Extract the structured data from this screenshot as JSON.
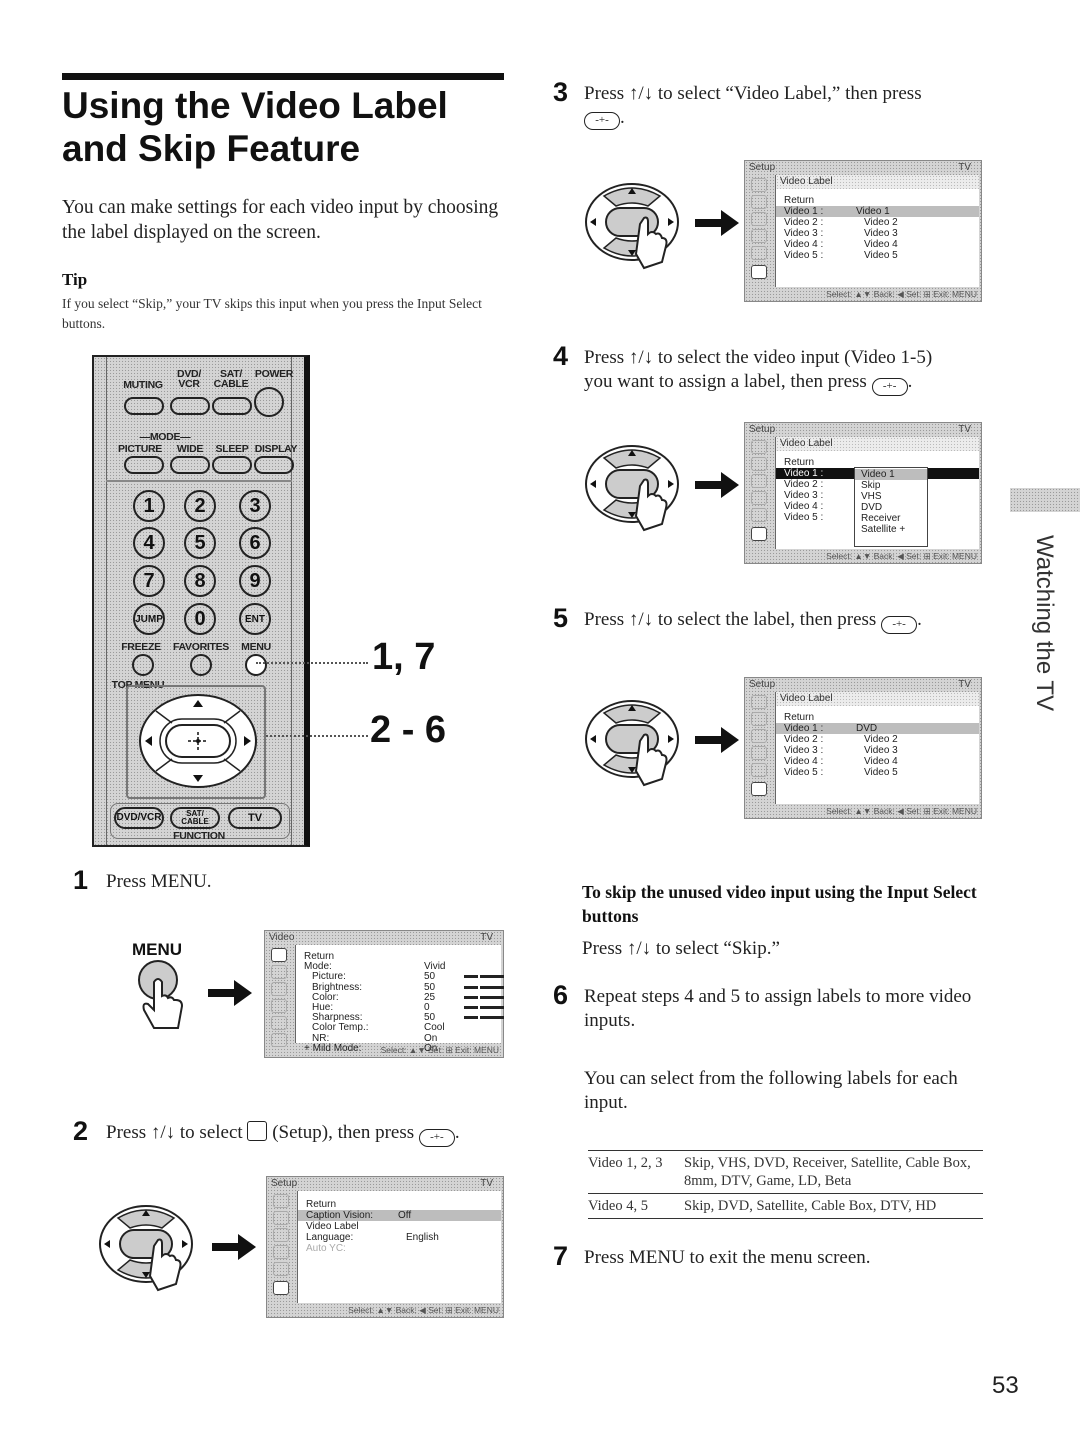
{
  "page": {
    "title_line1": "Using the Video Label",
    "title_line2": "and Skip Feature",
    "intro": "You can make settings for each video input by choosing the label displayed on the screen.",
    "tip_heading": "Tip",
    "tip_text": "If you select “Skip,” your TV skips this input when you press the Input Select buttons.",
    "side_tab": "Watching the TV",
    "page_number": "53"
  },
  "remote": {
    "row1_labels": [
      "MUTING",
      "DVD/\nVCR",
      "SAT/\nCABLE",
      "POWER"
    ],
    "mode_label": "MODE",
    "row2_labels": [
      "PICTURE",
      "WIDE",
      "SLEEP",
      "DISPLAY"
    ],
    "numbers": [
      "1",
      "2",
      "3",
      "4",
      "5",
      "6",
      "7",
      "8",
      "9"
    ],
    "row_bottom": [
      "JUMP",
      "0",
      "ENT"
    ],
    "row3_labels": [
      "FREEZE",
      "FAVORITES",
      "MENU"
    ],
    "top_menu_label": "TOP MENU",
    "function_buttons": [
      "DVD/VCR",
      "SAT/\nCABLE",
      "TV"
    ],
    "function_label": "FUNCTION",
    "callout_1": "1, 7",
    "callout_2": "2 - 6",
    "menu_label": "MENU"
  },
  "steps": [
    {
      "num": "1",
      "text": "Press MENU."
    },
    {
      "num": "2",
      "text_a": "Press ↑/↓ to select",
      "text_b": "(Setup), then press"
    },
    {
      "num": "3",
      "text": "Press ↑/↓ to select “Video Label,” then press"
    },
    {
      "num": "4",
      "text_a": "Press ↑/↓ to select the video input (Video 1-5)",
      "text_b": "you want to assign a label, then press"
    },
    {
      "num": "5",
      "text": "Press ↑/↓ to select the label, then press"
    },
    {
      "num": "6",
      "text": "Repeat steps 4 and 5 to assign labels to more video inputs."
    },
    {
      "num": "7",
      "text": "Press MENU to exit the menu screen."
    }
  ],
  "skip_section": {
    "heading": "To skip the unused video input using the Input Select buttons",
    "text": "Press ↑/↓ to select “Skip.”"
  },
  "labels_intro": "You can select from the following labels for each input.",
  "labels_table": [
    {
      "inputs": "Video 1, 2, 3",
      "labels": "Skip, VHS, DVD, Receiver, Satellite, Cable Box, 8mm, DTV, Game, LD, Beta"
    },
    {
      "inputs": "Video 4, 5",
      "labels": "Skip, DVD, Satellite, Cable Box, DTV, HD"
    }
  ],
  "osd_video": {
    "header": "Video",
    "tv": "TV",
    "rows": [
      {
        "label": "Return",
        "value": ""
      },
      {
        "label": "Mode:",
        "value": "Vivid"
      },
      {
        "label": "Picture:",
        "value": "50",
        "bar": 0.5
      },
      {
        "label": "Brightness:",
        "value": "50",
        "bar": 0.5
      },
      {
        "label": "Color:",
        "value": "25",
        "bar": 0.25
      },
      {
        "label": "Hue:",
        "value": "0",
        "bar": 0.5
      },
      {
        "label": "Sharpness:",
        "value": "50",
        "bar": 0.5
      },
      {
        "label": "Color Temp.:",
        "value": "Cool"
      },
      {
        "label": "NR:",
        "value": "On"
      },
      {
        "label": "Mild Mode:",
        "value": "On"
      }
    ],
    "footer": "Select: ▲▼  Set: ⊞  Exit: MENU"
  },
  "osd_setup": {
    "header": "Setup",
    "tv": "TV",
    "rows": [
      {
        "label": "Return",
        "value": ""
      },
      {
        "label": "Caption Vision:",
        "value": "Off"
      },
      {
        "label": "Video Label",
        "value": ""
      },
      {
        "label": "Language:",
        "value": "English"
      },
      {
        "label": "Auto YC:",
        "value": ""
      }
    ],
    "footer": "Select: ▲▼  Back: ◀  Set: ⊞  Exit: MENU"
  },
  "osd_label3": {
    "header": "Setup",
    "tv": "TV",
    "sub": "Video Label",
    "rows": [
      {
        "label": "Return",
        "value": ""
      },
      {
        "label": "Video 1 :",
        "value": "Video 1"
      },
      {
        "label": "Video 2 :",
        "value": "Video 2"
      },
      {
        "label": "Video 3 :",
        "value": "Video 3"
      },
      {
        "label": "Video 4 :",
        "value": "Video 4"
      },
      {
        "label": "Video 5 :",
        "value": "Video 5"
      }
    ],
    "footer": "Select: ▲▼  Back: ◀  Set: ⊞  Exit: MENU"
  },
  "osd_label4": {
    "header": "Setup",
    "tv": "TV",
    "sub": "Video Label",
    "rows": [
      {
        "label": "Return",
        "value": ""
      },
      {
        "label": "Video 1 :",
        "value": ""
      },
      {
        "label": "Video 2 :",
        "value": ""
      },
      {
        "label": "Video 3 :",
        "value": ""
      },
      {
        "label": "Video 4 :",
        "value": ""
      },
      {
        "label": "Video 5 :",
        "value": ""
      }
    ],
    "dropdown": [
      "Video 1",
      "Skip",
      "VHS",
      "DVD",
      "Receiver",
      "Satellite"
    ],
    "footer": "Select: ▲▼  Back: ◀  Set: ⊞  Exit: MENU"
  },
  "osd_label5": {
    "header": "Setup",
    "tv": "TV",
    "sub": "Video Label",
    "rows": [
      {
        "label": "Return",
        "value": ""
      },
      {
        "label": "Video 1 :",
        "value": "DVD"
      },
      {
        "label": "Video 2 :",
        "value": "Video 2"
      },
      {
        "label": "Video 3 :",
        "value": "Video 3"
      },
      {
        "label": "Video 4 :",
        "value": "Video 4"
      },
      {
        "label": "Video 5 :",
        "value": "Video 5"
      }
    ],
    "footer": "Select: ▲▼  Back: ◀  Set: ⊞  Exit: MENU"
  }
}
